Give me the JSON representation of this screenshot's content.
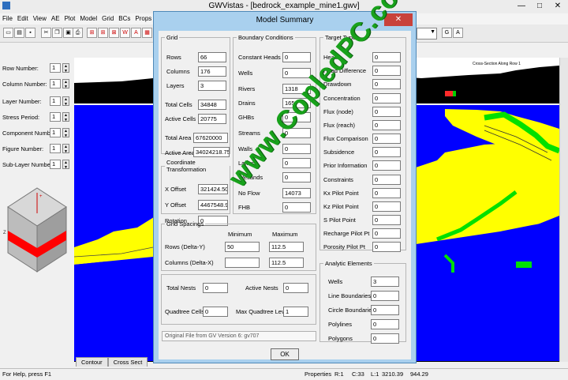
{
  "app": {
    "title": "GWVistas - [bedrock_example_mine1.gwv]",
    "window_controls": [
      "—",
      "□",
      "✕"
    ]
  },
  "menu": [
    "File",
    "Edit",
    "View",
    "AE",
    "Plot",
    "Model",
    "Grid",
    "BCs",
    "Props"
  ],
  "left_panel": {
    "fields": [
      {
        "label": "Row Number:",
        "value": "1"
      },
      {
        "label": "Column Number:",
        "value": "1"
      },
      {
        "label": "Layer Number:",
        "value": "1"
      },
      {
        "label": "Stress Period:",
        "value": "1"
      },
      {
        "label": "Component Number:",
        "value": "1"
      },
      {
        "label": "Figure Number:",
        "value": "1"
      },
      {
        "label": "Sub-Layer Number:",
        "value": "1"
      }
    ]
  },
  "cross_section_label": "Cross-Section Along Row 1",
  "tabs": [
    "Contour",
    "Cross Sect"
  ],
  "status": {
    "help": "For Help, press F1",
    "mode": "Properties",
    "row": "R:1",
    "col": "C:33",
    "l": "L:1",
    "x": "3210.39",
    "y": "944.29"
  },
  "dialog": {
    "title": "Model Summary",
    "close": "✕",
    "grid": {
      "legend": "Grid",
      "items": [
        {
          "label": "Rows",
          "value": "66"
        },
        {
          "label": "Columns",
          "value": "176"
        },
        {
          "label": "Layers",
          "value": "3"
        },
        {
          "label": "Total Cells",
          "value": "34848"
        },
        {
          "label": "Active Cells",
          "value": "20775"
        },
        {
          "label": "Total Area",
          "value": "67620000"
        },
        {
          "label": "Active Area",
          "value": "34024218.75"
        }
      ]
    },
    "coord": {
      "legend": "Coordinate Transformation",
      "items": [
        {
          "label": "X Offset",
          "value": "321424.50"
        },
        {
          "label": "Y Offset",
          "value": "4467548.9"
        },
        {
          "label": "Rotation",
          "value": "0"
        }
      ]
    },
    "bc": {
      "legend": "Boundary Conditions",
      "items": [
        {
          "label": "Constant Heads",
          "value": "0"
        },
        {
          "label": "Wells",
          "value": "0"
        },
        {
          "label": "Rivers",
          "value": "1318"
        },
        {
          "label": "Drains",
          "value": "165"
        },
        {
          "label": "GHBs",
          "value": "0"
        },
        {
          "label": "Streams",
          "value": "0"
        },
        {
          "label": "Walls",
          "value": "0"
        },
        {
          "label": "Lakes",
          "value": "0"
        },
        {
          "label": "Wetlands",
          "value": "0"
        },
        {
          "label": "No Flow",
          "value": "14073"
        },
        {
          "label": "FHB",
          "value": "0"
        }
      ]
    },
    "targets": {
      "legend": "Target Types",
      "items": [
        {
          "label": "Head",
          "value": "0"
        },
        {
          "label": "Head Difference",
          "value": "0"
        },
        {
          "label": "Drawdown",
          "value": "0"
        },
        {
          "label": "Concentration",
          "value": "0"
        },
        {
          "label": "Flux (node)",
          "value": "0"
        },
        {
          "label": "Flux (reach)",
          "value": "0"
        },
        {
          "label": "Flux Comparison",
          "value": "0"
        },
        {
          "label": "Subsidence",
          "value": "0"
        },
        {
          "label": "Prior Information",
          "value": "0"
        },
        {
          "label": "Constraints",
          "value": "0"
        },
        {
          "label": "Kx Pilot Point",
          "value": "0"
        },
        {
          "label": "Kz Pilot Point",
          "value": "0"
        },
        {
          "label": "S Pilot Point",
          "value": "0"
        },
        {
          "label": "Recharge Pilot Pt",
          "value": "0"
        },
        {
          "label": "Porosity Pilot Pt",
          "value": "0"
        }
      ]
    },
    "spacing": {
      "legend": "Grid Spacings",
      "min_label": "Minimum",
      "max_label": "Maximum",
      "rows_label": "Rows (Delta-Y)",
      "rows_min": "50",
      "rows_max": "112.5",
      "cols_label": "Columns (Delta-X)",
      "cols_min": "",
      "cols_max": "112.5"
    },
    "nests": {
      "total_label": "Total Nests",
      "total": "0",
      "active_label": "Active Nests",
      "active": "0",
      "quad_label": "Quadtree Cells",
      "quad": "0",
      "maxq_label": "Max Quadtree Level",
      "maxq": "1"
    },
    "analytic": {
      "legend": "Analytic Elements",
      "items": [
        {
          "label": "Wells",
          "value": "3"
        },
        {
          "label": "Line Boundaries",
          "value": "0"
        },
        {
          "label": "Circle Boundaries",
          "value": "0"
        },
        {
          "label": "Polylines",
          "value": "0"
        },
        {
          "label": "Polygons",
          "value": "0"
        }
      ]
    },
    "original_file": "Original File from GV Version 6: gv707",
    "ok": "OK"
  },
  "watermark": "www.CopledPC.com",
  "colors": {
    "blue": "#0000ff",
    "yellow": "#ffff00",
    "green": "#00e000",
    "red": "#ff0000",
    "dialog_frame": "#a9d0ee",
    "watermark": "#18a11b"
  }
}
